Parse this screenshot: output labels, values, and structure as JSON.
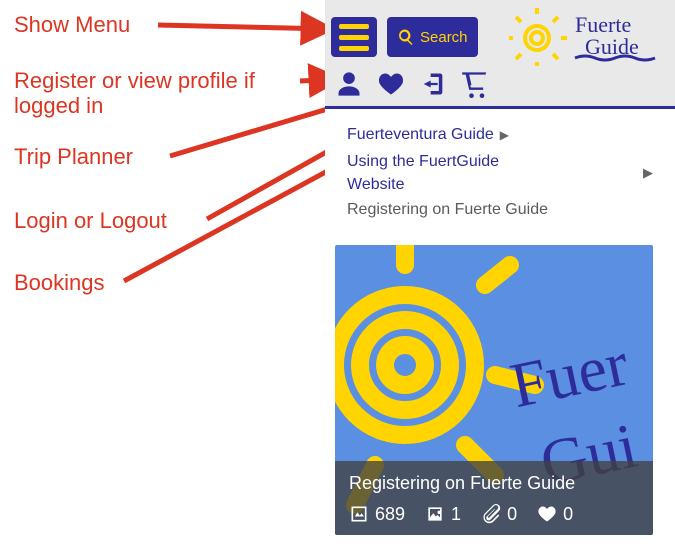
{
  "annotations": {
    "menu": "Show Menu",
    "profile": "Register or view profile if logged in",
    "planner": "Trip Planner",
    "login": "Login or Logout",
    "bookings": "Bookings"
  },
  "header": {
    "search_label": "Search",
    "logo_text1": "Fuerte",
    "logo_text2": "Guide"
  },
  "icons": {
    "menu": "hamburger-icon",
    "search": "magnifier-icon",
    "user": "user-icon",
    "heart": "heart-icon",
    "login": "login-icon",
    "cart": "cart-icon"
  },
  "breadcrumb": {
    "level1": "Fuerteventura Guide",
    "level2": "Using the FuertGuide Website",
    "current": "Registering on Fuerte Guide"
  },
  "card": {
    "title": "Registering on Fuerte Guide",
    "stats": {
      "views": "689",
      "images": "1",
      "attachments": "0",
      "likes": "0"
    }
  },
  "colors": {
    "brand_blue": "#2e2c9b",
    "brand_yellow": "#ffd400",
    "accent_red": "#dc3522",
    "sky": "#5a8fe1"
  }
}
